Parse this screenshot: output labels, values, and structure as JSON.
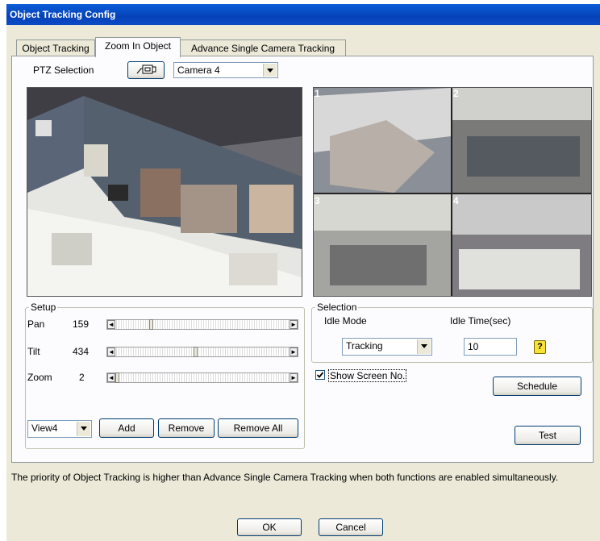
{
  "window": {
    "title": "Object Tracking Config"
  },
  "tabs": [
    {
      "label": "Object Tracking"
    },
    {
      "label": "Zoom In Object"
    },
    {
      "label": "Advance Single Camera Tracking"
    }
  ],
  "ptz": {
    "label": "PTZ Selection",
    "camera": "Camera 4"
  },
  "quad": {
    "n1": "1",
    "n2": "2",
    "n3": "3",
    "n4": "4"
  },
  "setup": {
    "title": "Setup",
    "pan": {
      "label": "Pan",
      "value": "159",
      "position": 0.2
    },
    "tilt": {
      "label": "Tilt",
      "value": "434",
      "position": 0.46
    },
    "zoom": {
      "label": "Zoom",
      "value": "2",
      "position": 0.0
    },
    "view": "View4",
    "add": "Add",
    "remove": "Remove",
    "remove_all": "Remove All"
  },
  "selection": {
    "title": "Selection",
    "idle_mode_label": "Idle Mode",
    "idle_mode": "Tracking",
    "idle_time_label": "Idle Time(sec)",
    "idle_time": "10",
    "help": "?"
  },
  "show_screen_no": {
    "label": "Show Screen No.",
    "checked": true
  },
  "schedule": "Schedule",
  "test": "Test",
  "note": "The priority of Object Tracking is higher than Advance Single Camera Tracking when both functions are enabled simultaneously.",
  "ok": "OK",
  "cancel": "Cancel"
}
